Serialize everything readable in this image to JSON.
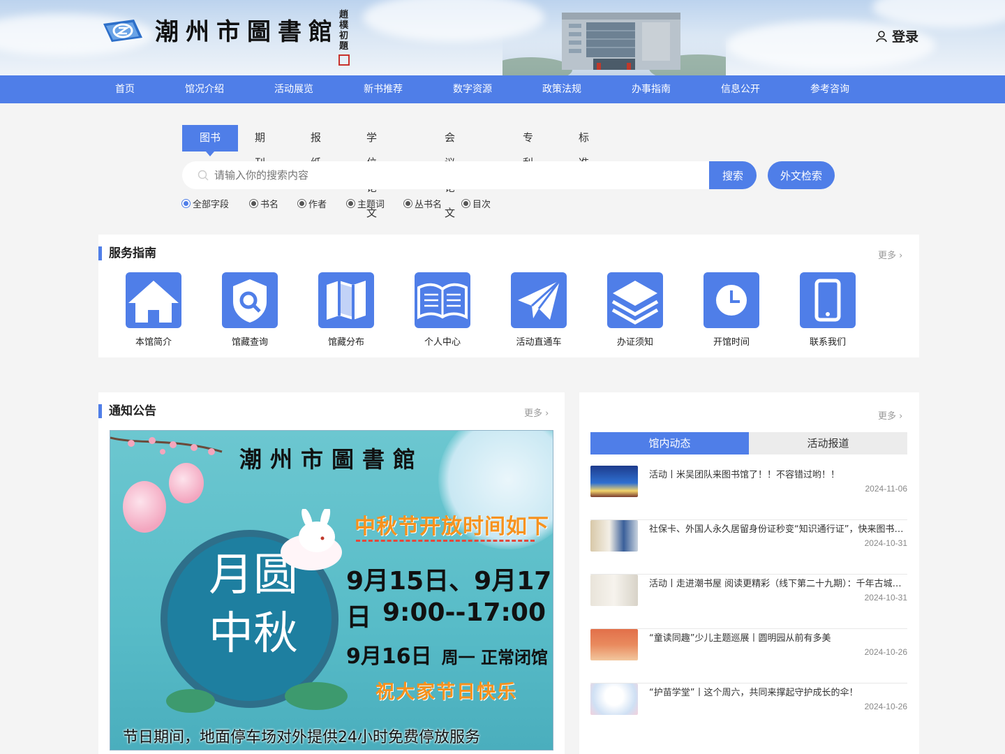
{
  "header": {
    "site_title": "潮州市圖書館",
    "calligraphy": "趙樸初題",
    "login_label": "登录"
  },
  "nav": {
    "items": [
      "首页",
      "馆况介绍",
      "活动展览",
      "新书推荐",
      "数字资源",
      "政策法规",
      "办事指南",
      "信息公开",
      "参考咨询"
    ]
  },
  "search": {
    "tabs": [
      "图书",
      "期刊",
      "报纸",
      "学位论文",
      "会议论文",
      "专利",
      "标准"
    ],
    "active_tab": "图书",
    "placeholder": "请输入你的搜索内容",
    "search_label": "搜索",
    "foreign_label": "外文检索",
    "fields": [
      "全部字段",
      "书名",
      "作者",
      "主题词",
      "丛书名",
      "目次"
    ],
    "selected_field": "全部字段"
  },
  "services": {
    "title": "服务指南",
    "more": "更多",
    "items": [
      {
        "label": "本馆简介",
        "icon": "home-icon"
      },
      {
        "label": "馆藏查询",
        "icon": "shield-search-icon"
      },
      {
        "label": "馆藏分布",
        "icon": "map-icon"
      },
      {
        "label": "个人中心",
        "icon": "open-book-icon"
      },
      {
        "label": "活动直通车",
        "icon": "paper-plane-icon"
      },
      {
        "label": "办证须知",
        "icon": "layers-icon"
      },
      {
        "label": "开馆时间",
        "icon": "clock-icon"
      },
      {
        "label": "联系我们",
        "icon": "phone-icon"
      }
    ]
  },
  "notice": {
    "title": "通知公告",
    "more": "更多",
    "poster": {
      "title": "潮州市圖書館",
      "circle_text_1": "月圆",
      "circle_text_2": "中秋",
      "subtitle": "中秋节开放时间如下",
      "line1": "9月15日、9月17日",
      "line2": "9:00--17:00",
      "line3_date": "9月16日",
      "line3_note": "周一 正常闭馆",
      "wish": "祝大家节日快乐",
      "footer": "节日期间，地面停车场对外提供24小时免费停放服务"
    }
  },
  "news": {
    "more": "更多",
    "tabs": [
      "馆内动态",
      "活动报道"
    ],
    "active_tab": "馆内动态",
    "items": [
      {
        "title": "活动丨米吴团队来图书馆了！！不容错过哟！！",
        "date": "2024-11-06"
      },
      {
        "title": "社保卡、外国人永久居留身份证秒变“知识通行证”，快来图书馆体验吧",
        "date": "2024-10-31"
      },
      {
        "title": "活动丨走进潮书屋 阅读更精彩（线下第二十九期）：千年古城潮州",
        "date": "2024-10-31"
      },
      {
        "title": "“童读同趣”少儿主题巡展丨圆明园从前有多美",
        "date": "2024-10-26"
      },
      {
        "title": "“护苗学堂”丨这个周六，共同来撑起守护成长的伞！",
        "date": "2024-10-26"
      }
    ]
  },
  "colors": {
    "accent": "#4f7ee8",
    "background": "#f4f4f4"
  }
}
